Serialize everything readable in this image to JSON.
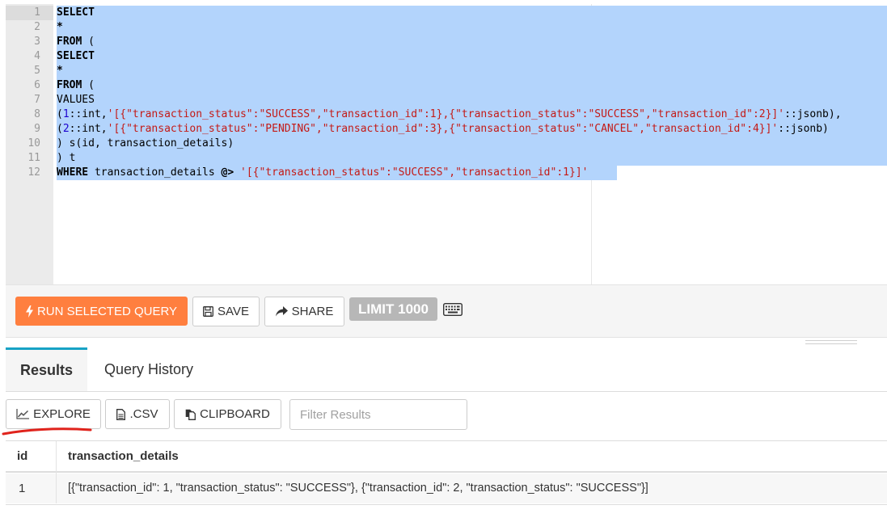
{
  "editor": {
    "line_numbers": [
      "1",
      "2",
      "3",
      "4",
      "5",
      "6",
      "7",
      "8",
      "9",
      "10",
      "11",
      "12"
    ],
    "lines": [
      [
        {
          "t": "SELECT",
          "c": "kw"
        }
      ],
      [
        {
          "t": "*",
          "c": "kw"
        }
      ],
      [
        {
          "t": "FROM",
          "c": "kw"
        },
        {
          "t": " (",
          "c": ""
        }
      ],
      [
        {
          "t": "SELECT",
          "c": "kw"
        }
      ],
      [
        {
          "t": "*",
          "c": "kw"
        }
      ],
      [
        {
          "t": "FROM",
          "c": "kw"
        },
        {
          "t": " (",
          "c": ""
        }
      ],
      [
        {
          "t": "VALUES",
          "c": ""
        }
      ],
      [
        {
          "t": "(",
          "c": ""
        },
        {
          "t": "1",
          "c": "num"
        },
        {
          "t": "::int,",
          "c": ""
        },
        {
          "t": "'[{\"transaction_status\":\"SUCCESS\",\"transaction_id\":1},{\"transaction_status\":\"SUCCESS\",\"transaction_id\":2}]'",
          "c": "str"
        },
        {
          "t": "::jsonb),",
          "c": ""
        }
      ],
      [
        {
          "t": "(",
          "c": ""
        },
        {
          "t": "2",
          "c": "num"
        },
        {
          "t": "::int,",
          "c": ""
        },
        {
          "t": "'[{\"transaction_status\":\"PENDING\",\"transaction_id\":3},{\"transaction_status\":\"CANCEL\",\"transaction_id\":4}]'",
          "c": "str"
        },
        {
          "t": "::jsonb)",
          "c": ""
        }
      ],
      [
        {
          "t": ") s(id, transaction_details)",
          "c": ""
        }
      ],
      [
        {
          "t": ") t",
          "c": ""
        }
      ],
      [
        {
          "t": "WHERE",
          "c": "kw"
        },
        {
          "t": " transaction_details ",
          "c": ""
        },
        {
          "t": "@>",
          "c": "kw"
        },
        {
          "t": " ",
          "c": ""
        },
        {
          "t": "'[{\"transaction_status\":\"SUCCESS\",\"transaction_id\":1}]'",
          "c": "str"
        }
      ]
    ]
  },
  "toolbar": {
    "run_label": "RUN SELECTED QUERY",
    "save_label": "SAVE",
    "share_label": "SHARE",
    "limit_label": "LIMIT 1000",
    "run_color": "#ff7f3f"
  },
  "tabs": [
    {
      "label": "Results",
      "active": true
    },
    {
      "label": "Query History",
      "active": false
    }
  ],
  "results_toolbar": {
    "explore_label": "EXPLORE",
    "csv_label": ".CSV",
    "clipboard_label": "CLIPBOARD",
    "filter_placeholder": "Filter Results"
  },
  "table": {
    "columns": [
      "id",
      "transaction_details"
    ],
    "rows": [
      [
        "1",
        "[{\"transaction_id\": 1, \"transaction_status\": \"SUCCESS\"}, {\"transaction_id\": 2, \"transaction_status\": \"SUCCESS\"}]"
      ]
    ]
  }
}
